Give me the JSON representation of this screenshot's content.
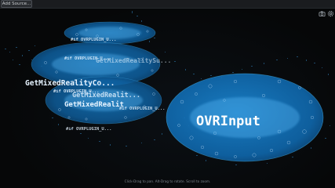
{
  "toolbar": {
    "add_source_label": "Add Source..."
  },
  "tools": {
    "camera_icon": "camera-icon",
    "settings_icon": "gear-icon"
  },
  "nodes": {
    "getmixedreality_1": "GetMixedRealityCo...",
    "getmixedreality_2": "GetMixedRealit...",
    "getmixedreality_3": "GetMixedRealit",
    "getmixedreality_partial": "GetMixedRealitySu...",
    "ovrplugin_1": "#if OVRPLUGIN_U...",
    "ovrplugin_2": "#if OVRPLUGIN_U...",
    "ovrplugin_3": "#if OVRPLUGIN_U...",
    "ovrplugin_4": "#if OVRPLUGIN_U...",
    "ovrplugin_5": "#if OVRPLUGIN_U...",
    "ovrinput": "OVRInput"
  },
  "status": {
    "hint": "Click-Drag to pan. Alt-Drag to rotate. Scroll to zoom."
  },
  "colors": {
    "background": "#050506",
    "node_fill": "#0f6fb5",
    "node_glow": "#1f9fe6",
    "label": "#e6f3ff",
    "toolbar": "#1a1c1f"
  }
}
